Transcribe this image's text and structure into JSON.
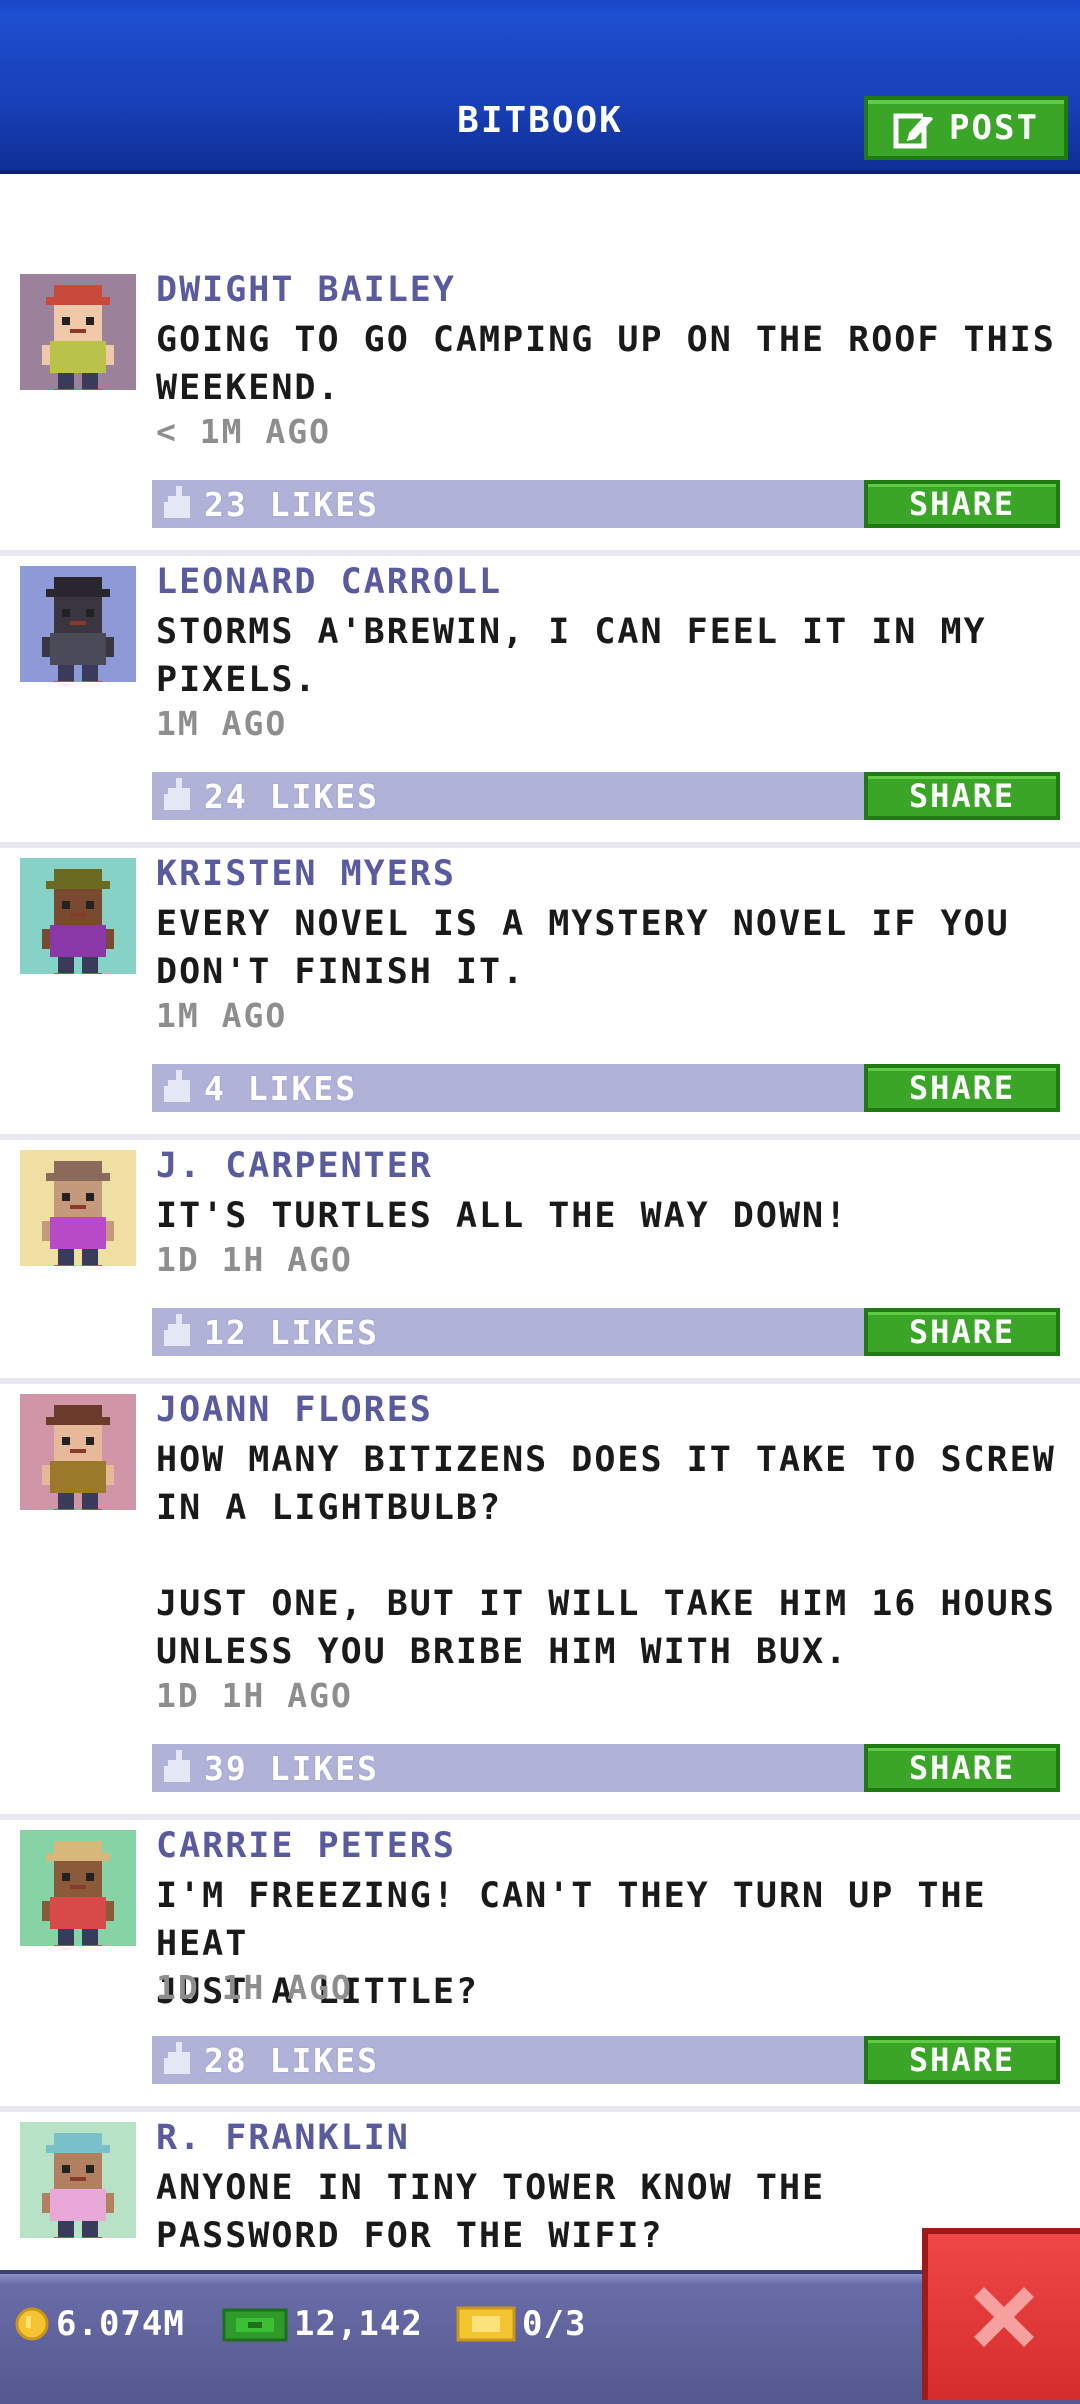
{
  "header": {
    "title": "BITBOOK",
    "post_label": "POST"
  },
  "posts": [
    {
      "name": "DWIGHT BAILEY",
      "text": "GOING TO GO CAMPING UP ON THE ROOF THIS\nWEEKEND.",
      "time": "< 1M AGO",
      "likes": "23 LIKES",
      "share": "SHARE",
      "avatar_bg": "#9b8199",
      "skin": "#f2c9a8",
      "hat": "#c84a3a",
      "shirt": "#b9c24a"
    },
    {
      "name": "LEONARD CARROLL",
      "text": "STORMS A'BREWIN, I CAN FEEL IT IN MY\nPIXELS.",
      "time": "1M AGO",
      "likes": "24 LIKES",
      "share": "SHARE",
      "avatar_bg": "#8e9ad8",
      "skin": "#3a3640",
      "hat": "#2a2630",
      "shirt": "#4a4a58"
    },
    {
      "name": "KRISTEN MYERS",
      "text": "EVERY NOVEL IS A MYSTERY NOVEL IF YOU\nDON'T FINISH IT.",
      "time": "1M AGO",
      "likes": "4 LIKES",
      "share": "SHARE",
      "avatar_bg": "#86d2c6",
      "skin": "#7a4a30",
      "hat": "#6a6a20",
      "shirt": "#8a38a8"
    },
    {
      "name": "J. CARPENTER",
      "text": "IT'S TURTLES ALL THE WAY DOWN!",
      "time": "1D 1H AGO",
      "likes": "12 LIKES",
      "share": "SHARE",
      "avatar_bg": "#efdfa2",
      "skin": "#c49a7a",
      "hat": "#8a6a5a",
      "shirt": "#b84ac8"
    },
    {
      "name": "JOANN FLORES",
      "text": "HOW MANY BITIZENS DOES IT TAKE TO SCREW\nIN A LIGHTBULB?\n\nJUST ONE, BUT IT WILL TAKE HIM 16 HOURS\nUNLESS YOU BRIBE HIM WITH BUX.",
      "time": "1D 1H AGO",
      "likes": "39 LIKES",
      "share": "SHARE",
      "avatar_bg": "#d195a8",
      "skin": "#e8b89a",
      "hat": "#6a3a2a",
      "shirt": "#9a7a2a"
    },
    {
      "name": "CARRIE PETERS",
      "text": "I'M FREEZING! CAN'T THEY TURN UP THE HEAT\nJUST A LITTLE?",
      "time": "1D 1H AGO",
      "likes": "28 LIKES",
      "share": "SHARE",
      "avatar_bg": "#86d4a6",
      "skin": "#8a5a3a",
      "hat": "#d8b87a",
      "shirt": "#d84a4a"
    },
    {
      "name": "R. FRANKLIN",
      "text": "ANYONE IN TINY TOWER KNOW THE\nPASSWORD FOR THE WIFI?",
      "time": "",
      "likes": "",
      "share": "",
      "avatar_bg": "#b8e2c6",
      "skin": "#b08060",
      "hat": "#7ac0c8",
      "shirt": "#e8a8d8"
    }
  ],
  "status": {
    "coins": "6.074M",
    "bux": "12,142",
    "tickets": "0/3"
  },
  "colors": {
    "header_blue": "#1a45c8",
    "share_green": "#3aa526",
    "likes_bar": "#b0b2d8",
    "close_red": "#e03a3a"
  }
}
